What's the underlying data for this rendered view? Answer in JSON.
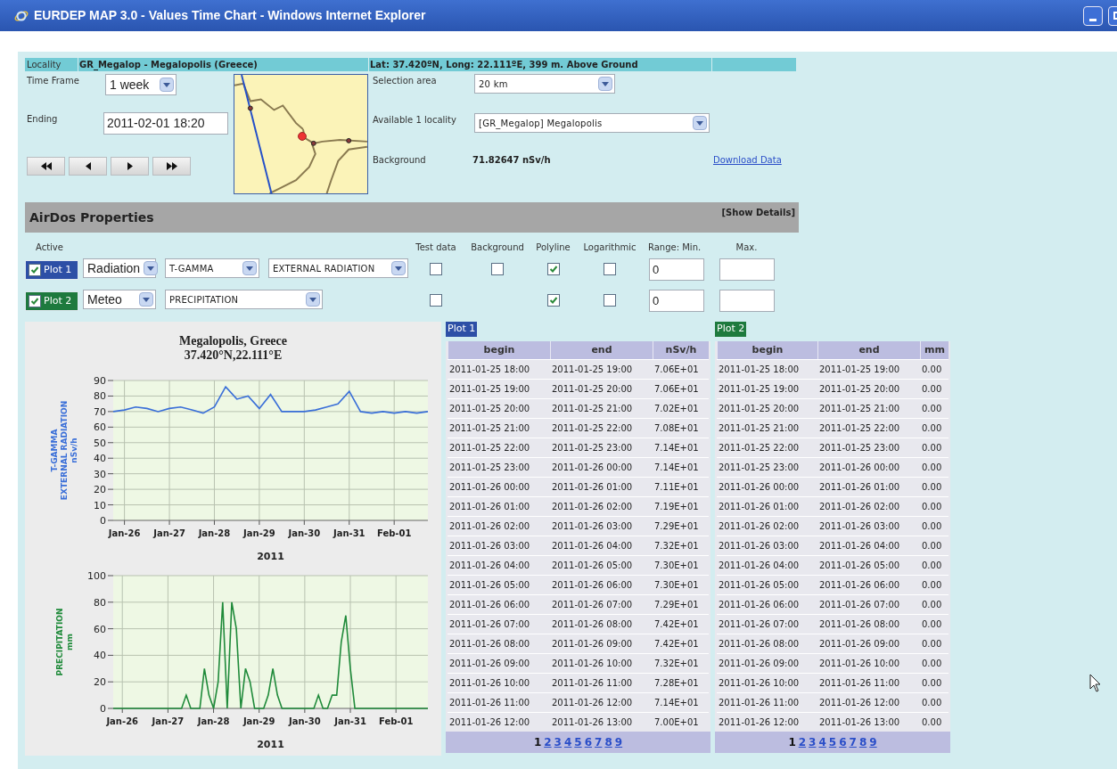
{
  "window": {
    "title": "EURDEP MAP 3.0 - Values Time Chart - Windows Internet Explorer"
  },
  "locality": {
    "label": "Locality",
    "name": "GR_Megalop - Megalopolis (Greece)",
    "coordinates": "Lat: 37.420ºN, Long: 22.111ºE, 399 m. Above Ground"
  },
  "form": {
    "time_frame": {
      "label": "Time Frame",
      "value": "1 week"
    },
    "ending": {
      "label": "Ending",
      "value": "2011-02-01 18:20"
    },
    "selection_area": {
      "label": "Selection area",
      "value": "20 km"
    },
    "available": {
      "label": "Available 1 locality",
      "value": "[GR_Megalop] Megalopolis"
    },
    "background": {
      "label": "Background",
      "value": "71.82647 nSv/h"
    },
    "download_link": "Download Data"
  },
  "properties": {
    "title": "AirDos Properties",
    "toggle": "[Show Details]",
    "columns": {
      "active": "Active",
      "test_data": "Test data",
      "background": "Background",
      "polyline": "Polyline",
      "logarithmic": "Logarithmic",
      "min": "Range: Min.",
      "max": "Max."
    },
    "plots": [
      {
        "label": "Plot 1",
        "color": "#2d4fa6",
        "active": true,
        "selects": [
          "Radiation",
          "T-GAMMA",
          "EXTERNAL RADIATION"
        ],
        "test_data": false,
        "background": false,
        "polyline": true,
        "logarithmic": false,
        "min": "0"
      },
      {
        "label": "Plot 2",
        "color": "#1e7a3e",
        "active": true,
        "selects": [
          "Meteo",
          "PRECIPITATION"
        ],
        "test_data": false,
        "polyline": true,
        "logarithmic": false,
        "min": "0"
      }
    ]
  },
  "charts": {
    "title": "Megalopolis, Greece",
    "subtitle": "37.420°N,22.111°E",
    "plots": [
      {
        "chart_data": {
          "type": "line",
          "grid": true,
          "xlabel": "2011",
          "ylabel": "T-GAMMA\nEXTERNAL RADIATION\nnSv/h",
          "ylim": [
            0,
            90
          ],
          "yticks": [
            0,
            10,
            20,
            30,
            40,
            50,
            60,
            70,
            80,
            90
          ],
          "categories": [
            null,
            "Jan-26",
            null,
            null,
            null,
            "Jan-27",
            null,
            null,
            null,
            "Jan-28",
            null,
            null,
            null,
            "Jan-29",
            null,
            null,
            null,
            "Jan-30",
            null,
            null,
            null,
            "Jan-31",
            null,
            null,
            null,
            "Feb-01",
            null,
            null,
            null
          ],
          "series": [
            {
              "color": "#3a6fd8",
              "values": [
                70,
                71,
                73,
                72,
                70,
                72,
                73,
                71,
                69,
                73,
                86,
                78,
                80,
                72,
                81,
                70,
                70,
                70,
                71,
                73,
                75,
                83,
                70,
                69,
                70,
                69,
                70,
                69,
                70
              ]
            }
          ]
        }
      },
      {
        "chart_data": {
          "type": "line",
          "grid": true,
          "xlabel": "2011",
          "ylabel": "PRECIPITATION\nmm",
          "ylim": [
            0,
            100
          ],
          "yticks": [
            0,
            20,
            40,
            60,
            80,
            100
          ],
          "categories": [
            null,
            null,
            "Jan-26",
            null,
            null,
            null,
            null,
            null,
            null,
            null,
            null,
            null,
            "Jan-27",
            null,
            null,
            null,
            null,
            null,
            null,
            null,
            null,
            null,
            "Jan-28",
            null,
            null,
            null,
            null,
            null,
            null,
            null,
            null,
            null,
            "Jan-29",
            null,
            null,
            null,
            null,
            null,
            null,
            null,
            null,
            null,
            "Jan-30",
            null,
            null,
            null,
            null,
            null,
            null,
            null,
            null,
            null,
            "Jan-31",
            null,
            null,
            null,
            null,
            null,
            null,
            null,
            null,
            null,
            "Feb-01",
            null,
            null,
            null,
            null,
            null,
            null,
            null
          ],
          "series": [
            {
              "color": "#1f8a3a",
              "values": [
                0,
                0,
                0,
                0,
                0,
                0,
                0,
                0,
                0,
                0,
                0,
                0,
                0,
                0,
                0,
                0,
                10,
                0,
                0,
                0,
                30,
                10,
                0,
                20,
                80,
                0,
                80,
                60,
                0,
                30,
                20,
                0,
                0,
                0,
                10,
                30,
                10,
                0,
                0,
                0,
                0,
                0,
                0,
                0,
                0,
                10,
                0,
                0,
                10,
                10,
                50,
                70,
                30,
                0,
                0,
                0,
                0,
                0,
                0,
                0,
                0,
                0,
                0,
                0,
                0,
                0,
                0,
                0,
                0,
                0
              ]
            }
          ]
        }
      }
    ]
  },
  "tables": [
    {
      "label": "Plot 1",
      "color": "#2d4fa6",
      "columns": [
        "begin",
        "end",
        "nSv/h"
      ],
      "rows": [
        [
          "2011-01-25 18:00",
          "2011-01-25 19:00",
          "7.06E+01"
        ],
        [
          "2011-01-25 19:00",
          "2011-01-25 20:00",
          "7.06E+01"
        ],
        [
          "2011-01-25 20:00",
          "2011-01-25 21:00",
          "7.02E+01"
        ],
        [
          "2011-01-25 21:00",
          "2011-01-25 22:00",
          "7.08E+01"
        ],
        [
          "2011-01-25 22:00",
          "2011-01-25 23:00",
          "7.14E+01"
        ],
        [
          "2011-01-25 23:00",
          "2011-01-26 00:00",
          "7.14E+01"
        ],
        [
          "2011-01-26 00:00",
          "2011-01-26 01:00",
          "7.11E+01"
        ],
        [
          "2011-01-26 01:00",
          "2011-01-26 02:00",
          "7.19E+01"
        ],
        [
          "2011-01-26 02:00",
          "2011-01-26 03:00",
          "7.29E+01"
        ],
        [
          "2011-01-26 03:00",
          "2011-01-26 04:00",
          "7.32E+01"
        ],
        [
          "2011-01-26 04:00",
          "2011-01-26 05:00",
          "7.30E+01"
        ],
        [
          "2011-01-26 05:00",
          "2011-01-26 06:00",
          "7.30E+01"
        ],
        [
          "2011-01-26 06:00",
          "2011-01-26 07:00",
          "7.29E+01"
        ],
        [
          "2011-01-26 07:00",
          "2011-01-26 08:00",
          "7.42E+01"
        ],
        [
          "2011-01-26 08:00",
          "2011-01-26 09:00",
          "7.42E+01"
        ],
        [
          "2011-01-26 09:00",
          "2011-01-26 10:00",
          "7.32E+01"
        ],
        [
          "2011-01-26 10:00",
          "2011-01-26 11:00",
          "7.28E+01"
        ],
        [
          "2011-01-26 11:00",
          "2011-01-26 12:00",
          "7.14E+01"
        ],
        [
          "2011-01-26 12:00",
          "2011-01-26 13:00",
          "7.00E+01"
        ]
      ],
      "pages": [
        {
          "label": "1",
          "selected": true
        },
        {
          "label": "2",
          "selected": false
        },
        {
          "label": "3",
          "selected": false
        },
        {
          "label": "4",
          "selected": false
        },
        {
          "label": "5",
          "selected": false
        },
        {
          "label": "6",
          "selected": false
        },
        {
          "label": "7",
          "selected": false
        },
        {
          "label": "8",
          "selected": false
        },
        {
          "label": "9",
          "selected": false
        }
      ]
    },
    {
      "label": "Plot 2",
      "color": "#1e7a3e",
      "columns": [
        "begin",
        "end",
        "mm"
      ],
      "rows": [
        [
          "2011-01-25 18:00",
          "2011-01-25 19:00",
          "0.00"
        ],
        [
          "2011-01-25 19:00",
          "2011-01-25 20:00",
          "0.00"
        ],
        [
          "2011-01-25 20:00",
          "2011-01-25 21:00",
          "0.00"
        ],
        [
          "2011-01-25 21:00",
          "2011-01-25 22:00",
          "0.00"
        ],
        [
          "2011-01-25 22:00",
          "2011-01-25 23:00",
          "0.00"
        ],
        [
          "2011-01-25 23:00",
          "2011-01-26 00:00",
          "0.00"
        ],
        [
          "2011-01-26 00:00",
          "2011-01-26 01:00",
          "0.00"
        ],
        [
          "2011-01-26 01:00",
          "2011-01-26 02:00",
          "0.00"
        ],
        [
          "2011-01-26 02:00",
          "2011-01-26 03:00",
          "0.00"
        ],
        [
          "2011-01-26 03:00",
          "2011-01-26 04:00",
          "0.00"
        ],
        [
          "2011-01-26 04:00",
          "2011-01-26 05:00",
          "0.00"
        ],
        [
          "2011-01-26 05:00",
          "2011-01-26 06:00",
          "0.00"
        ],
        [
          "2011-01-26 06:00",
          "2011-01-26 07:00",
          "0.00"
        ],
        [
          "2011-01-26 07:00",
          "2011-01-26 08:00",
          "0.00"
        ],
        [
          "2011-01-26 08:00",
          "2011-01-26 09:00",
          "0.00"
        ],
        [
          "2011-01-26 09:00",
          "2011-01-26 10:00",
          "0.00"
        ],
        [
          "2011-01-26 10:00",
          "2011-01-26 11:00",
          "0.00"
        ],
        [
          "2011-01-26 11:00",
          "2011-01-26 12:00",
          "0.00"
        ],
        [
          "2011-01-26 12:00",
          "2011-01-26 13:00",
          "0.00"
        ]
      ],
      "pages": [
        {
          "label": "1",
          "selected": true
        },
        {
          "label": "2",
          "selected": false
        },
        {
          "label": "3",
          "selected": false
        },
        {
          "label": "4",
          "selected": false
        },
        {
          "label": "5",
          "selected": false
        },
        {
          "label": "6",
          "selected": false
        },
        {
          "label": "7",
          "selected": false
        },
        {
          "label": "8",
          "selected": false
        },
        {
          "label": "9",
          "selected": false
        }
      ]
    }
  ]
}
